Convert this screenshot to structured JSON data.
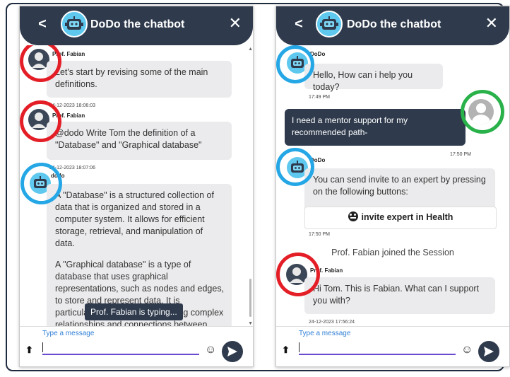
{
  "left_phone": {
    "header": {
      "back_icon": "chevron-left-icon",
      "title": "DoDo the chatbot",
      "close_icon": "close-icon"
    },
    "messages": [
      {
        "sender": "Prof. Fabian",
        "text": "Let's start by revising some of the main definitions.",
        "time": "24-12-2023 18:06:03"
      },
      {
        "sender": "Prof. Fabian",
        "text": "@dodo Write Tom the definition of a \"Database\"  and \"Graphical database\"",
        "time": "24-12-2023 18:07:06"
      },
      {
        "sender": "dodo",
        "text_p1": "A \"Database\" is a structured collection of data that is organized and stored in a computer system. It allows for efficient storage, retrieval, and manipulation of data.",
        "text_p2": "A \"Graphical database\" is a type of database that uses graphical representations, such as nodes and edges, to store and represent data. It is particularly useful for representing complex relationships and connections between"
      }
    ],
    "typing_indicator": "Prof. Fabian is typing...",
    "composer": {
      "placeholder": "Type a message",
      "emoji_icon": "emoji-icon",
      "send_icon": "send-icon",
      "upload_icon": "upload-icon"
    }
  },
  "right_phone": {
    "header": {
      "back_icon": "chevron-left-icon",
      "title": "DoDo the chatbot",
      "close_icon": "close-icon"
    },
    "messages": [
      {
        "sender": "DoDo",
        "text": "Hello, How can i help you today?",
        "time": "17:49 PM"
      },
      {
        "sender": "user",
        "text": "I need a mentor support for my recommended path-",
        "time": "17:50 PM"
      },
      {
        "sender": "DoDo",
        "text": "You can send invite to an expert by pressing on the following buttons:",
        "button": "invite expert in Health",
        "time": "17:50 PM"
      },
      {
        "system": "Prof. Fabian joined the Session"
      },
      {
        "sender": "Prof. Fabian",
        "text": "Hi Tom. This is Fabian. What can I support you with?",
        "time": "24-12-2023 17:56:24"
      }
    ],
    "composer": {
      "placeholder": "Type a message",
      "emoji_icon": "emoji-icon",
      "send_icon": "send-icon",
      "upload_icon": "upload-icon"
    }
  },
  "highlight_colors": {
    "red": "#e41e26",
    "blue": "#25a7e6",
    "green": "#29b14a"
  }
}
